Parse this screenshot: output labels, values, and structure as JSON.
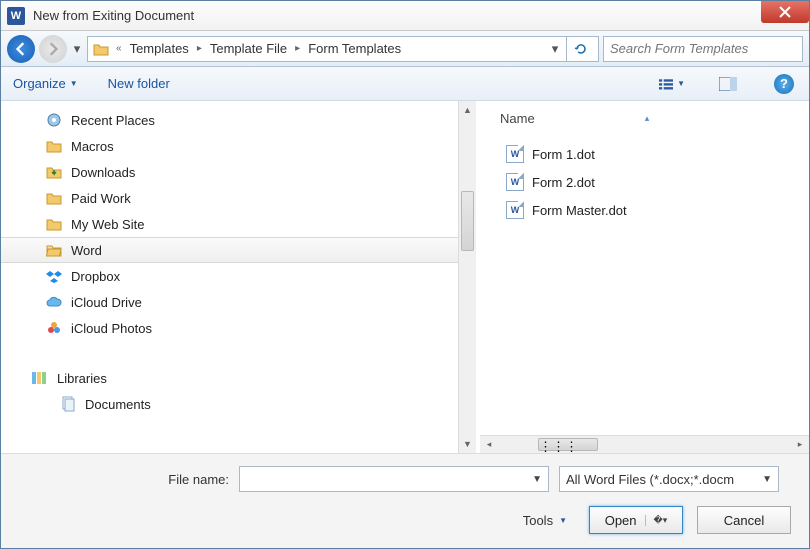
{
  "window": {
    "title": "New from Exiting Document"
  },
  "nav": {
    "breadcrumb": [
      "Templates",
      "Template File",
      "Form Templates"
    ],
    "search_placeholder": "Search Form Templates"
  },
  "toolbar": {
    "organize": "Organize",
    "newfolder": "New folder"
  },
  "tree": {
    "items": [
      {
        "label": "Recent Places",
        "icon": "recent"
      },
      {
        "label": "Macros",
        "icon": "folder"
      },
      {
        "label": "Downloads",
        "icon": "downloads"
      },
      {
        "label": "Paid Work",
        "icon": "folder"
      },
      {
        "label": "My Web Site",
        "icon": "folder"
      },
      {
        "label": "Word",
        "icon": "folder",
        "selected": true
      },
      {
        "label": "Dropbox",
        "icon": "dropbox"
      },
      {
        "label": "iCloud Drive",
        "icon": "icloud"
      },
      {
        "label": "iCloud Photos",
        "icon": "photos"
      }
    ],
    "libraries": "Libraries",
    "documents": "Documents"
  },
  "filelist": {
    "col_name": "Name",
    "files": [
      {
        "name": "Form 1.dot"
      },
      {
        "name": "Form 2.dot"
      },
      {
        "name": "Form Master.dot"
      }
    ]
  },
  "footer": {
    "filename_label": "File name:",
    "filename_value": "",
    "filetype": "All Word Files (*.docx;*.docm",
    "tools": "Tools",
    "open": "Open",
    "cancel": "Cancel"
  }
}
